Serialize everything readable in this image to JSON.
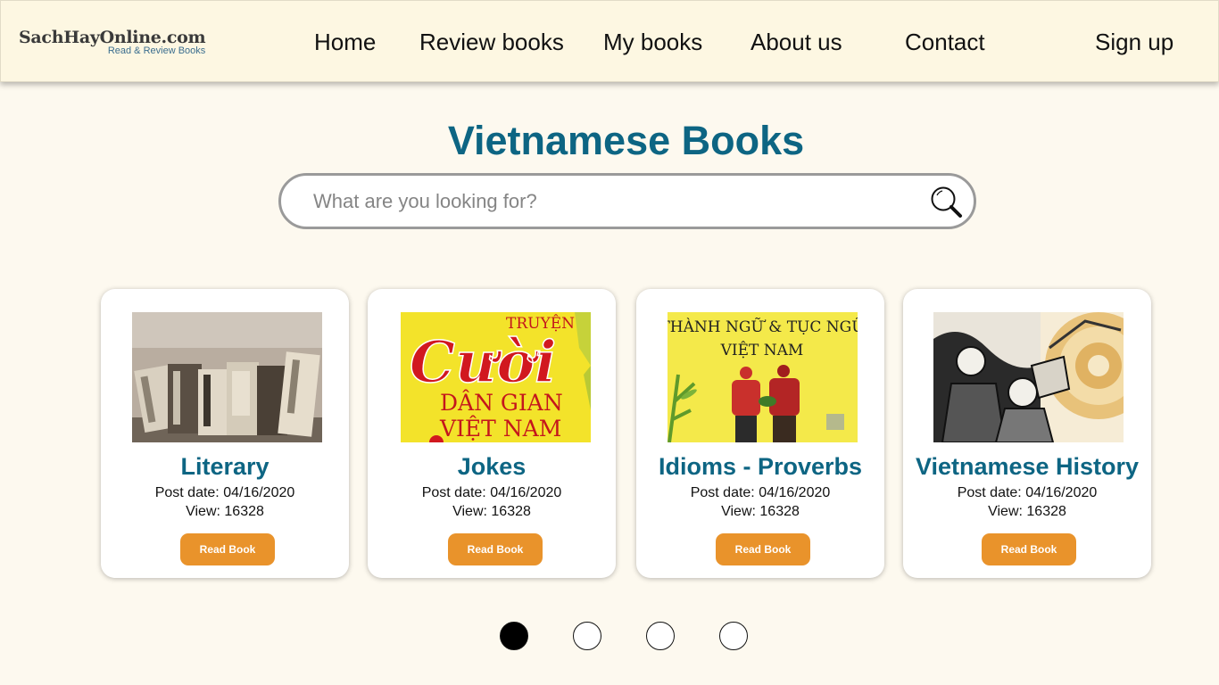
{
  "header": {
    "logo_main": "SachHayOnline.com",
    "logo_sub": "Read & Review Books",
    "nav": [
      "Home",
      "Review books",
      "My books",
      "About us",
      "Contact"
    ],
    "signup": "Sign up"
  },
  "page_title": "Vietnamese Books",
  "search": {
    "placeholder": "What are you looking for?",
    "icon": "magnifier-icon"
  },
  "cards": [
    {
      "title": "Literary",
      "post_date": "Post date: 04/16/2020",
      "views": "View: 16328",
      "button": "Read Book"
    },
    {
      "title": "Jokes",
      "post_date": "Post date: 04/16/2020",
      "views": "View: 16328",
      "button": "Read Book",
      "cover_text": [
        "TRUYỆN",
        "Cười",
        "DÂN GIAN",
        "VIỆT NAM"
      ]
    },
    {
      "title": "Idioms - Proverbs",
      "post_date": "Post date: 04/16/2020",
      "views": "View: 16328",
      "button": "Read Book",
      "cover_text": [
        "THÀNH NGỮ & TỤC NGỮ",
        "VIỆT NAM"
      ]
    },
    {
      "title": "Vietnamese History",
      "post_date": "Post date: 04/16/2020",
      "views": "View: 16328",
      "button": "Read Book"
    }
  ],
  "pagination": {
    "count": 4,
    "active_index": 0
  },
  "colors": {
    "accent": "#0d6583",
    "button": "#e9932b",
    "header_bg": "#fdf7e2",
    "page_bg": "#fdf9ef"
  }
}
